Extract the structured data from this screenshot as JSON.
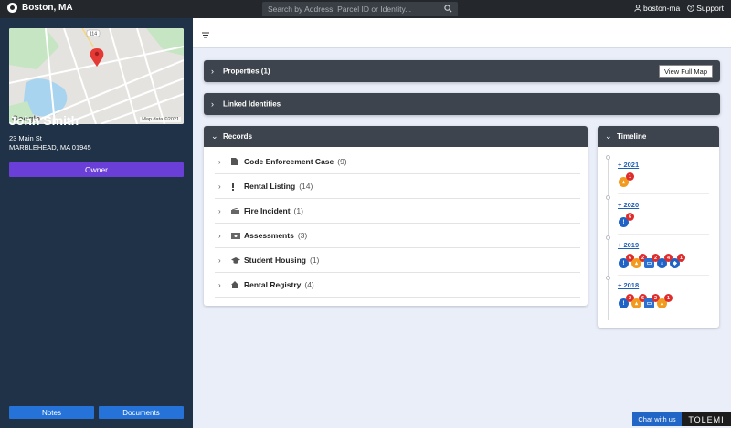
{
  "topbar": {
    "city": "Boston, MA",
    "search_placeholder": "Search by Address, Parcel ID or Identity...",
    "user": "boston-ma",
    "support": "Support"
  },
  "sidebar": {
    "map": {
      "attribution": "Map data ©2021",
      "provider": "Google"
    },
    "name": "John Smith",
    "address_line1": "23 Main St",
    "address_line2": "MARBLEHEAD, MA 01945",
    "role": "Owner",
    "notes_label": "Notes",
    "documents_label": "Documents"
  },
  "sections": {
    "properties": {
      "label": "Properties (1)",
      "button": "View Full Map"
    },
    "linked": {
      "label": "Linked Identities"
    }
  },
  "records": {
    "title": "Records",
    "items": [
      {
        "name": "Code Enforcement Case",
        "count": "(9)",
        "icon": "document-icon"
      },
      {
        "name": "Rental Listing",
        "count": "(14)",
        "icon": "exclamation-icon"
      },
      {
        "name": "Fire Incident",
        "count": "(1)",
        "icon": "fire-truck-icon"
      },
      {
        "name": "Assessments",
        "count": "(3)",
        "icon": "money-icon"
      },
      {
        "name": "Student Housing",
        "count": "(1)",
        "icon": "graduation-cap-icon"
      },
      {
        "name": "Rental Registry",
        "count": "(4)",
        "icon": "home-icon"
      }
    ]
  },
  "timeline": {
    "title": "Timeline",
    "years": [
      {
        "label": "+ 2021",
        "events": [
          {
            "type": "orange",
            "count": "1"
          }
        ]
      },
      {
        "label": "+ 2020",
        "events": [
          {
            "type": "blue",
            "count": "6"
          }
        ]
      },
      {
        "label": "+ 2019",
        "events": [
          {
            "type": "blue",
            "count": "6"
          },
          {
            "type": "orange",
            "count": "2"
          },
          {
            "type": "doc",
            "count": "2"
          },
          {
            "type": "blue-home",
            "count": "4"
          },
          {
            "type": "blue-cap",
            "count": "1"
          }
        ]
      },
      {
        "label": "+ 2018",
        "events": [
          {
            "type": "blue",
            "count": "2"
          },
          {
            "type": "orange",
            "count": "6"
          },
          {
            "type": "doc",
            "count": "2"
          },
          {
            "type": "orange",
            "count": "1"
          }
        ]
      }
    ]
  },
  "footer": {
    "chat": "Chat with us",
    "brand": "TOLEMI"
  },
  "colors": {
    "topbar": "#24282d",
    "sidebar": "#1f3247",
    "owner": "#6a3fd8",
    "accent": "#2573d8",
    "badge": "#e02b2b"
  }
}
